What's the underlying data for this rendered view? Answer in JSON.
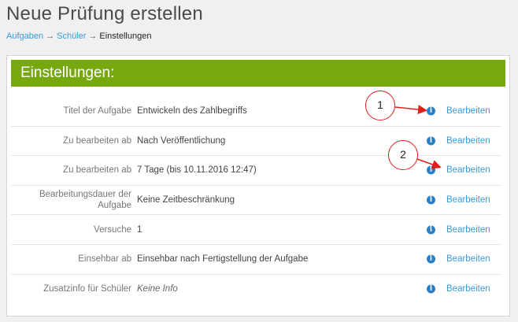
{
  "page": {
    "title": "Neue Prüfung erstellen",
    "breadcrumb": [
      {
        "label": "Aufgaben",
        "link": true
      },
      {
        "label": "Schüler",
        "link": true
      },
      {
        "label": "Einstellungen",
        "link": false
      }
    ],
    "breadcrumb_separator": "→"
  },
  "card": {
    "header": "Einstellungen:",
    "info_glyph": "i",
    "rows": [
      {
        "label": "Titel der Aufgabe",
        "value": "Entwickeln des Zahlbegriffs",
        "action": "Bearbeiten"
      },
      {
        "label": "Zu bearbeiten ab",
        "value": "Nach Veröffentlichung",
        "action": "Bearbeiten"
      },
      {
        "label": "Zu bearbeiten ab",
        "value": "7 Tage (bis 10.11.2016 12:47)",
        "action": "Bearbeiten"
      },
      {
        "label": "Bearbeitungsdauer der Aufgabe",
        "value": "Keine Zeitbeschränkung",
        "action": "Bearbeiten"
      },
      {
        "label": "Versuche",
        "value": "1",
        "action": "Bearbeiten"
      },
      {
        "label": "Einsehbar ab",
        "value": "Einsehbar nach Fertigstellung der Aufgabe",
        "action": "Bearbeiten"
      },
      {
        "label": "Zusatzinfo für Schüler",
        "value": "Keine Info",
        "action": "Bearbeiten"
      }
    ]
  },
  "annotations": [
    {
      "number": "1"
    },
    {
      "number": "2"
    }
  ],
  "colors": {
    "header_green": "#77a80e",
    "link_blue": "#3a9ad9",
    "info_blue": "#2a7fc4",
    "annotation_red": "#e0201c"
  }
}
